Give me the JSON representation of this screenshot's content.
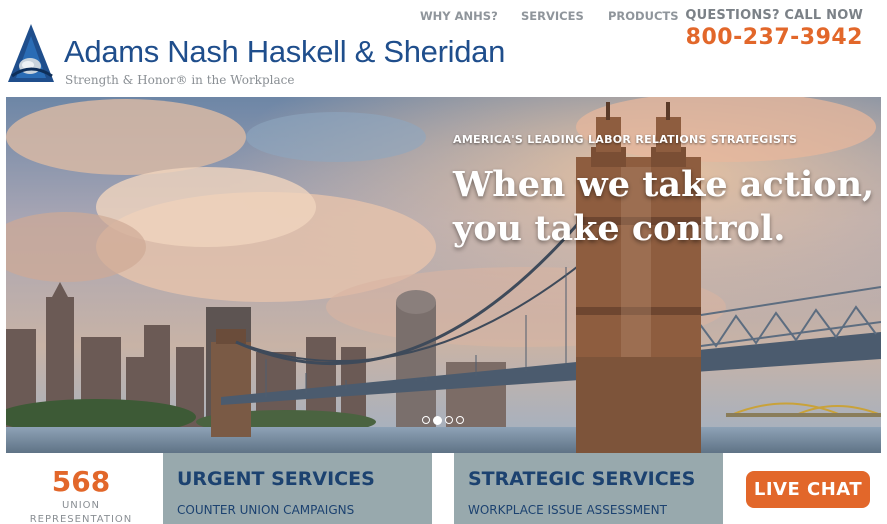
{
  "header": {
    "brand_name": "Adams Nash Haskell & Sheridan",
    "tagline": "Strength & Honor® in the Workplace",
    "nav": {
      "why": "WHY ANHS?",
      "services": "SERVICES",
      "products": "PRODUCTS"
    },
    "questions_label": "QUESTIONS? CALL NOW",
    "phone": "800-237-3942"
  },
  "hero": {
    "kicker": "AMERICA'S LEADING LABOR RELATIONS STRATEGISTS",
    "headline_line1": "When we take action,",
    "headline_line2": "you take control.",
    "slide_count": 4,
    "active_slide": 2
  },
  "stat": {
    "number": "568",
    "label_line1": "UNION",
    "label_line2": "REPRESENTATION"
  },
  "panels": {
    "urgent": {
      "title": "URGENT SERVICES",
      "item1": "COUNTER UNION CAMPAIGNS"
    },
    "strategic": {
      "title": "STRATEGIC SERVICES",
      "item1": "WORKPLACE ISSUE ASSESSMENT"
    }
  },
  "live_chat": "LIVE CHAT",
  "colors": {
    "brand_blue": "#1f4e8c",
    "accent_orange": "#e2672a",
    "panel_gray": "#98a9ad",
    "nav_gray": "#8f959b"
  },
  "icons": {
    "logo": "triangle-a-logo"
  }
}
